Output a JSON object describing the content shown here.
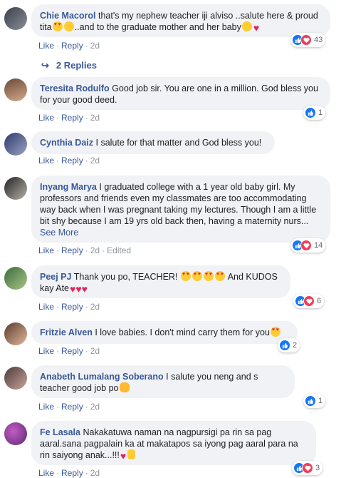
{
  "colors": {
    "link": "#385898",
    "bubble": "#f0f2f5",
    "like": "#1877f2",
    "love": "#f33e58"
  },
  "actions": {
    "like": "Like",
    "reply": "Reply",
    "sep": "·"
  },
  "comments": [
    {
      "author": "Chie Macorol",
      "text": "that's my nephew teacher iji alviso ..salute here & proud tita",
      "text2": "..and to the graduate mother and her baby",
      "time": "2d",
      "reactions": "43"
    },
    {
      "author": "Teresita Rodulfo",
      "text": "Good job sir. You are one in a million. God bless you for your good deed.",
      "time": "2d",
      "reactions": "1"
    },
    {
      "author": "Cynthia Daiz",
      "text": "I salute for that matter and God bless you!",
      "time": "2d"
    },
    {
      "author": "Inyang Marya",
      "text": "I graduated college with a 1 year old baby girl. My professors and friends even my classmates are too accommodating way back when I was pregnant taking my lectures. Though I am a little bit shy because I am 19 yrs old back then, having a maternity nurs...",
      "see_more": "See More",
      "time": "2d",
      "edited": "Edited",
      "reactions": "14"
    },
    {
      "author": "Peej PJ",
      "text": "Thank you po, TEACHER!",
      "text2": "And KUDOS kay Ate",
      "time": "2d",
      "reactions": "6"
    },
    {
      "author": "Fritzie Alven",
      "text": "I love babies. I don't mind carry them for you",
      "time": "2d",
      "reactions": "2"
    },
    {
      "author": "Anabeth Lumalang Soberano",
      "text": "I salute you neng and s teacher good job po",
      "time": "2d",
      "reactions": "1"
    },
    {
      "author": "Fe Lasala",
      "text": "Nakakatuwa naman na nagpursigi pa rin sa pag aaral.sana pagpalain ka at makatapos sa iyong pag aaral para na rin saiyong anak...!!!",
      "time": "2d",
      "reactions": "3"
    }
  ],
  "replies_label": "2 Replies",
  "icons": {
    "reply_arrow": "reply-arrow-icon",
    "like": "thumbs-up-icon",
    "love": "heart-icon"
  }
}
